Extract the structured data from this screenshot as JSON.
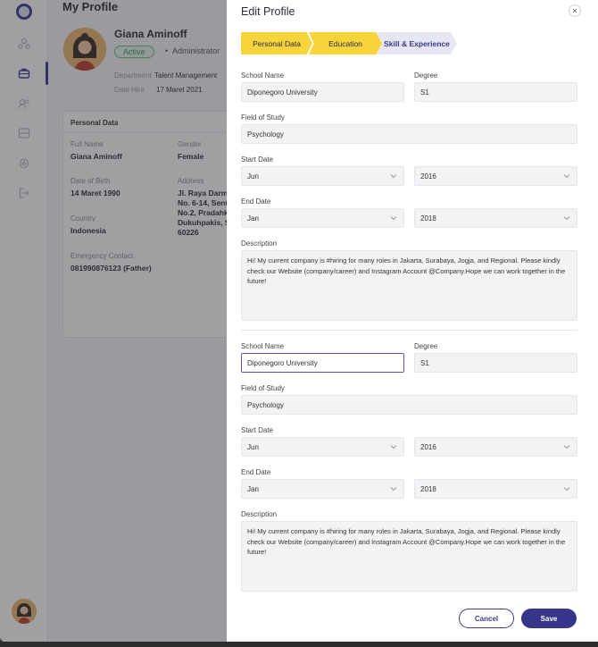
{
  "app": {
    "page_title": "My Profile",
    "profile": {
      "name": "Giana Aminoff",
      "status": "Active",
      "role": "Administrator",
      "department_label": "Department",
      "department": "Talent Management",
      "date_hire_label": "Date Hire",
      "date_hire": "17 Maret 2021"
    },
    "personal_card": {
      "title": "Personal Data",
      "full_name_label": "Full Name",
      "full_name": "Giana Aminoff",
      "gender_label": "Gender",
      "gender": "Female",
      "dob_label": "Date of Birth",
      "dob": "14 Maret 1990",
      "address_label": "Address",
      "address_l1": "Jl. Raya Darmo",
      "address_l2": "No. 6-14, Sent",
      "address_l3": "No.2, Pradahk",
      "address_l4": "Dukuhpakis, S",
      "address_l5": "60226",
      "country_label": "Country",
      "country": "Indonesia",
      "emergency_label": "Emergency Contact",
      "emergency": "081990876123 (Father)"
    }
  },
  "drawer": {
    "title": "Edit Profile",
    "close_icon": "close-icon",
    "steps": [
      "Personal Data",
      "Education",
      "Skill & Experience"
    ],
    "labels": {
      "school": "School Name",
      "degree": "Degree",
      "field": "Field of Study",
      "start": "Start Date",
      "end": "End Date",
      "description": "Description"
    },
    "entries": [
      {
        "school": "Diponegoro University",
        "degree": "S1",
        "field": "Psychology",
        "start_month": "Jun",
        "start_year": "2016",
        "end_month": "Jan",
        "end_year": "2018",
        "description": "Hi! My current company is #hiring for many roles in Jakarta, Surabaya, Jogja, and Regional. Please kindly check our Website (company/career) and Instagram Account @Company.Hope we can work together in the future!"
      },
      {
        "school": "Diponegoro University",
        "degree": "S1",
        "field": "Psychology",
        "start_month": "Jun",
        "start_year": "2016",
        "end_month": "Jan",
        "end_year": "2018",
        "description": "Hi! My current company is #hiring for many roles in Jakarta, Surabaya, Jogja, and Regional. Please kindly check our Website (company/career) and Instagram Account @Company.Hope we can work together in the future!"
      }
    ],
    "cancel_label": "Cancel",
    "save_label": "Save"
  },
  "colors": {
    "brand": "#36358a",
    "step_done": "#f8d43c",
    "step_current": "#e6e6f4",
    "active_badge": "#3d9a5f"
  }
}
